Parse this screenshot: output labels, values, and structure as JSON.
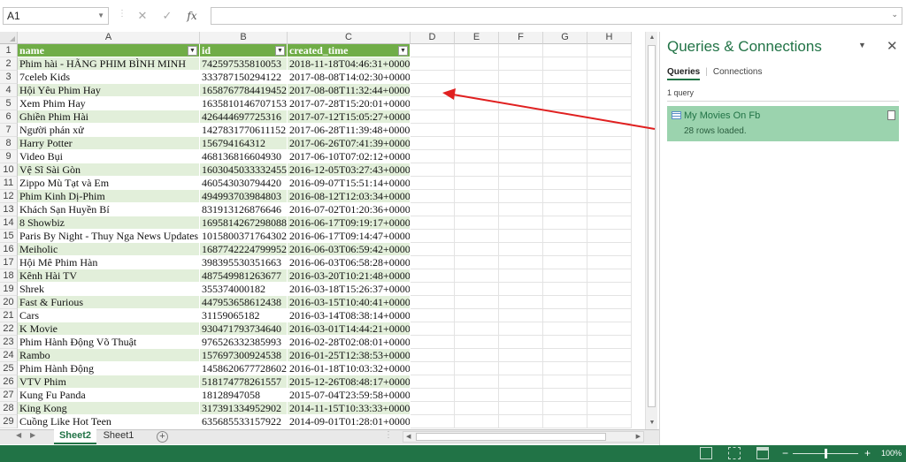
{
  "formula_bar": {
    "name_box": "A1",
    "cancel_icon": "✕",
    "enter_icon": "✓",
    "function_icon": "fx",
    "formula": ""
  },
  "columns": [
    "A",
    "B",
    "C",
    "D",
    "E",
    "F",
    "G",
    "H"
  ],
  "table": {
    "headers": [
      "name",
      "id",
      "created_time"
    ],
    "rows": [
      [
        "Phim hài - HÃNG PHIM BÌNH MINH",
        "742597535810053",
        "2018-11-18T04:46:31+0000"
      ],
      [
        "7celeb Kids",
        "333787150294122",
        "2017-08-08T14:02:30+0000"
      ],
      [
        "Hội Yêu Phim Hay",
        "1658767784419452",
        "2017-08-08T11:32:44+0000"
      ],
      [
        "Xem Phim Hay",
        "1635810146707153",
        "2017-07-28T15:20:01+0000"
      ],
      [
        "Ghiền Phim Hài",
        "426444697725316",
        "2017-07-12T15:05:27+0000"
      ],
      [
        "Người phán xử",
        "1427831770611152",
        "2017-06-28T11:39:48+0000"
      ],
      [
        "Harry Potter",
        "156794164312",
        "2017-06-26T07:41:39+0000"
      ],
      [
        "Video Bụi",
        "468136816604930",
        "2017-06-10T07:02:12+0000"
      ],
      [
        "Vệ Sĩ Sài Gòn",
        "1603045033332455",
        "2016-12-05T03:27:43+0000"
      ],
      [
        "Zippo Mù Tạt và Em",
        "460543030794420",
        "2016-09-07T15:51:14+0000"
      ],
      [
        "Phim Kinh Dị-Phim",
        "494993703984803",
        "2016-08-12T12:03:34+0000"
      ],
      [
        "Khách Sạn Huyền Bí",
        "831913126876646",
        "2016-07-02T01:20:36+0000"
      ],
      [
        "8 Showbiz",
        "1695814267298088",
        "2016-06-17T09:19:17+0000"
      ],
      [
        "Paris By Night - Thuy Nga News Updates",
        "1015800371764302",
        "2016-06-17T09:14:47+0000"
      ],
      [
        "Meiholic",
        "1687742224799952",
        "2016-06-03T06:59:42+0000"
      ],
      [
        "Hội Mê Phim Hàn",
        "398395530351663",
        "2016-06-03T06:58:28+0000"
      ],
      [
        "Kênh Hài TV",
        "487549981263677",
        "2016-03-20T10:21:48+0000"
      ],
      [
        "Shrek",
        "355374000182",
        "2016-03-18T15:26:37+0000"
      ],
      [
        "Fast & Furious",
        "447953658612438",
        "2016-03-15T10:40:41+0000"
      ],
      [
        "Cars",
        "31159065182",
        "2016-03-14T08:38:14+0000"
      ],
      [
        "K Movie",
        "930471793734640",
        "2016-03-01T14:44:21+0000"
      ],
      [
        "Phim Hành Động Võ Thuật",
        "976526332385993",
        "2016-02-28T02:08:01+0000"
      ],
      [
        "Rambo",
        "157697300924538",
        "2016-01-25T12:38:53+0000"
      ],
      [
        "Phim Hành Động",
        "1458620677728602",
        "2016-01-18T10:03:32+0000"
      ],
      [
        "VTV Phim",
        "518174778261557",
        "2015-12-26T08:48:17+0000"
      ],
      [
        "Kung Fu Panda",
        "18128947058",
        "2015-07-04T23:59:58+0000"
      ],
      [
        "King Kong",
        "317391334952902",
        "2014-11-15T10:33:33+0000"
      ],
      [
        "Cuồng Like Hot Teen",
        "635685533157922",
        "2014-09-01T01:28:01+0000"
      ]
    ]
  },
  "sheet_tabs": {
    "active": "Sheet2",
    "inactive": "Sheet1",
    "add_icon": "+"
  },
  "status_bar": {
    "zoom": "100%",
    "zoom_out": "−",
    "zoom_in": "+"
  },
  "queries_pane": {
    "title": "Queries & Connections",
    "menu_icon": "▼",
    "close_icon": "✕",
    "tab_queries": "Queries",
    "tab_connections": "Connections",
    "count_label": "1 query",
    "items": [
      {
        "name": "My Movies On Fb",
        "status": "28 rows loaded."
      }
    ]
  },
  "colors": {
    "excel_green": "#217346",
    "table_header": "#70ad47",
    "table_band": "#e2efda",
    "query_selected": "#9bd3ae",
    "annotation_arrow": "#e02020"
  }
}
